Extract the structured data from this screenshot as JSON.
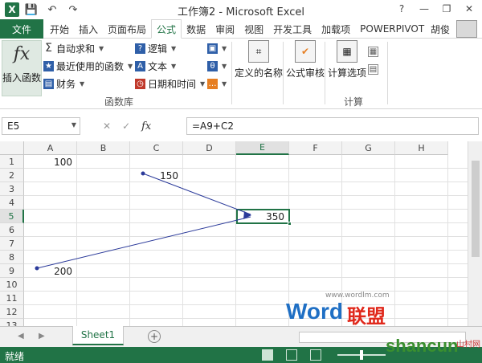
{
  "title": {
    "text": "工作簿2 - Microsoft Excel",
    "minimize": "—",
    "restore": "❐",
    "close": "✕",
    "help": "?"
  },
  "qat": {
    "logo": "X",
    "save": "💾",
    "undo": "↶",
    "redo": "↷"
  },
  "tabs": {
    "file": "文件",
    "items": [
      "开始",
      "插入",
      "页面布局",
      "公式",
      "数据",
      "审阅",
      "视图",
      "开发工具",
      "加载项",
      "POWERPIVOT"
    ],
    "active": "公式",
    "user": "胡俊"
  },
  "ribbon": {
    "insert_function": "插入函数",
    "fx_symbol": "fx",
    "autosum": "自动求和",
    "recent": "最近使用的函数",
    "financial": "财务",
    "logical": "逻辑",
    "text": "文本",
    "datetime": "日期和时间",
    "group_library": "函数库",
    "defined_names": "定义的名称",
    "formula_auditing": "公式审核",
    "calc_options": "计算选项",
    "group_calc": "计算"
  },
  "formula_bar": {
    "name_box": "E5",
    "cancel": "✕",
    "enter": "✓",
    "fx": "fx",
    "formula": "=A9+C2"
  },
  "grid": {
    "columns": [
      "A",
      "B",
      "C",
      "D",
      "E",
      "F",
      "G",
      "H"
    ],
    "rows": [
      "1",
      "2",
      "3",
      "4",
      "5",
      "6",
      "7",
      "8",
      "9",
      "10",
      "11",
      "12",
      "13"
    ],
    "selected_column": "E",
    "selected_row": "5",
    "cells": {
      "A1": "100",
      "C2": "150",
      "E5": "350",
      "A9": "200"
    },
    "trace_color": "#2b3a9a"
  },
  "sheets": {
    "tabs": [
      "Sheet1"
    ],
    "add": "+"
  },
  "status": {
    "text": "就绪"
  },
  "watermarks": {
    "url": "www.wordlm.com",
    "word": "Word",
    "lianmeng": "联盟",
    "shancun": "shancun",
    "net": "山村网"
  }
}
